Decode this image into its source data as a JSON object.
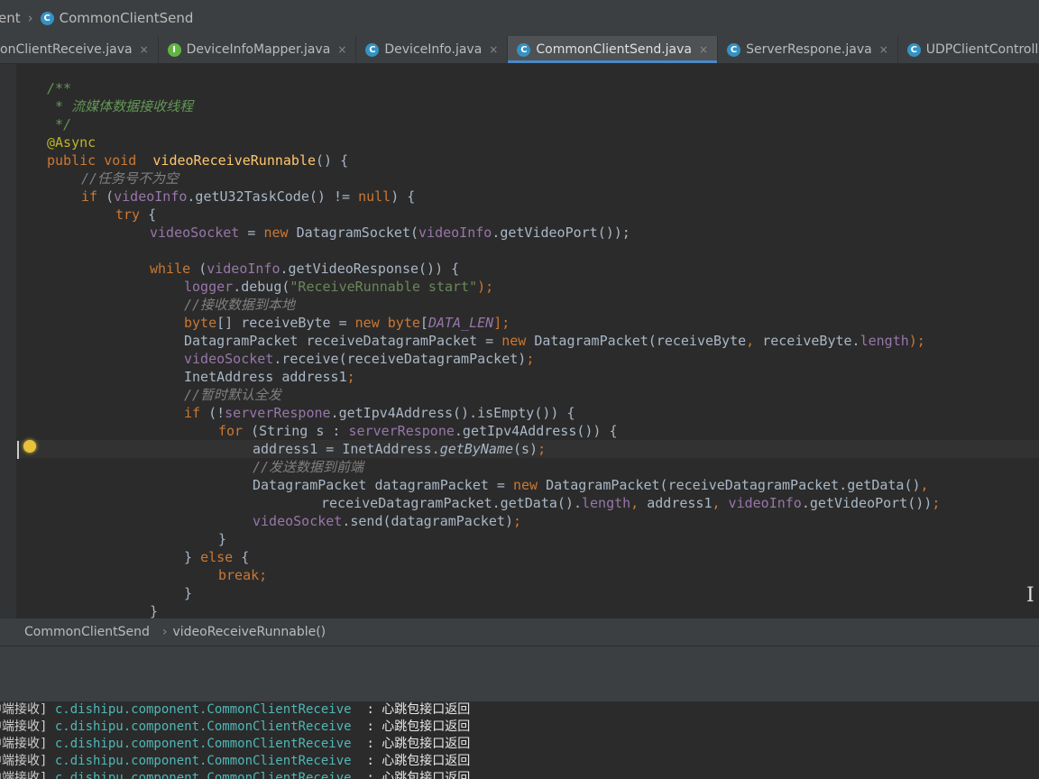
{
  "nav": {
    "crumb_partial": "ent",
    "file": "CommonClientSend"
  },
  "tabs": [
    {
      "label": "onClientReceive.java",
      "icon": "class",
      "active": false
    },
    {
      "label": "DeviceInfoMapper.java",
      "icon": "interface",
      "active": false
    },
    {
      "label": "DeviceInfo.java",
      "icon": "class",
      "active": false
    },
    {
      "label": "CommonClientSend.java",
      "icon": "class",
      "active": true
    },
    {
      "label": "ServerRespone.java",
      "icon": "class",
      "active": false
    },
    {
      "label": "UDPClientController.java",
      "icon": "class",
      "active": false
    }
  ],
  "tab_close_glyph": "×",
  "editor": {
    "lines": [
      {
        "indent": 0,
        "tokens": [
          {
            "t": "/**",
            "c": "doc"
          }
        ]
      },
      {
        "indent": 0,
        "tokens": [
          {
            "t": " * 流媒体数据接收线程",
            "c": "doc"
          }
        ]
      },
      {
        "indent": 0,
        "tokens": [
          {
            "t": " */",
            "c": "doc"
          }
        ]
      },
      {
        "indent": 0,
        "tokens": [
          {
            "t": "@Async",
            "c": "ann"
          }
        ]
      },
      {
        "indent": 0,
        "tokens": [
          {
            "t": "public void ",
            "c": "kw"
          },
          {
            "t": " videoReceiveRunnable",
            "c": "fn"
          },
          {
            "t": "() {",
            "c": ""
          }
        ]
      },
      {
        "indent": 1,
        "tokens": [
          {
            "t": "//任务号不为空",
            "c": "cm"
          }
        ]
      },
      {
        "indent": 1,
        "tokens": [
          {
            "t": "if ",
            "c": "kw"
          },
          {
            "t": "(",
            "c": ""
          },
          {
            "t": "videoInfo",
            "c": "fld"
          },
          {
            "t": ".getU32TaskCode() != ",
            "c": ""
          },
          {
            "t": "null",
            "c": "kw"
          },
          {
            "t": ") {",
            "c": ""
          }
        ]
      },
      {
        "indent": 2,
        "tokens": [
          {
            "t": "try ",
            "c": "kw"
          },
          {
            "t": "{",
            "c": ""
          }
        ]
      },
      {
        "indent": 3,
        "tokens": [
          {
            "t": "videoSocket",
            "c": "fld"
          },
          {
            "t": " = ",
            "c": ""
          },
          {
            "t": "new ",
            "c": "kw"
          },
          {
            "t": "DatagramSocket(",
            "c": ""
          },
          {
            "t": "videoInfo",
            "c": "fld"
          },
          {
            "t": ".getVideoPort());",
            "c": ""
          }
        ]
      },
      {
        "indent": 0,
        "tokens": []
      },
      {
        "indent": 3,
        "tokens": [
          {
            "t": "while ",
            "c": "kw"
          },
          {
            "t": "(",
            "c": ""
          },
          {
            "t": "videoInfo",
            "c": "fld"
          },
          {
            "t": ".getVideoResponse()) {",
            "c": ""
          }
        ]
      },
      {
        "indent": 4,
        "tokens": [
          {
            "t": "logger",
            "c": "fld"
          },
          {
            "t": ".debug(",
            "c": ""
          },
          {
            "t": "\"ReceiveRunnable start\"",
            "c": "str"
          },
          {
            "t": ");",
            "c": "kw"
          }
        ]
      },
      {
        "indent": 4,
        "tokens": [
          {
            "t": "//接收数据到本地",
            "c": "cm"
          }
        ]
      },
      {
        "indent": 4,
        "tokens": [
          {
            "t": "byte",
            "c": "kw"
          },
          {
            "t": "[] receiveByte = ",
            "c": ""
          },
          {
            "t": "new byte",
            "c": "kw"
          },
          {
            "t": "[",
            "c": ""
          },
          {
            "t": "DATA_LEN",
            "c": "fld ital"
          },
          {
            "t": "];",
            "c": "kw"
          }
        ]
      },
      {
        "indent": 4,
        "tokens": [
          {
            "t": "DatagramPacket receiveDatagramPacket = ",
            "c": ""
          },
          {
            "t": "new ",
            "c": "kw"
          },
          {
            "t": "DatagramPacket(receiveByte",
            "c": ""
          },
          {
            "t": ", ",
            "c": "kw"
          },
          {
            "t": "receiveByte.",
            "c": ""
          },
          {
            "t": "length",
            "c": "fld"
          },
          {
            "t": ");",
            "c": "kw"
          }
        ]
      },
      {
        "indent": 4,
        "tokens": [
          {
            "t": "videoSocket",
            "c": "fld"
          },
          {
            "t": ".receive(receiveDatagramPacket)",
            "c": ""
          },
          {
            "t": ";",
            "c": "kw"
          }
        ]
      },
      {
        "indent": 4,
        "tokens": [
          {
            "t": "InetAddress address1",
            "c": ""
          },
          {
            "t": ";",
            "c": "kw"
          }
        ]
      },
      {
        "indent": 4,
        "tokens": [
          {
            "t": "//暂时默认全发",
            "c": "cm"
          }
        ]
      },
      {
        "indent": 4,
        "tokens": [
          {
            "t": "if ",
            "c": "kw"
          },
          {
            "t": "(!",
            "c": ""
          },
          {
            "t": "serverRespone",
            "c": "fld"
          },
          {
            "t": ".getIpv4Address().isEmpty()) {",
            "c": ""
          }
        ]
      },
      {
        "indent": 5,
        "tokens": [
          {
            "t": "for ",
            "c": "kw"
          },
          {
            "t": "(String s : ",
            "c": ""
          },
          {
            "t": "serverRespone",
            "c": "fld"
          },
          {
            "t": ".getIpv4Address()) {",
            "c": ""
          }
        ]
      },
      {
        "indent": 6,
        "tokens": [
          {
            "t": "address1 = InetAddress.",
            "c": ""
          },
          {
            "t": "getByName",
            "c": "ital"
          },
          {
            "t": "(s)",
            "c": ""
          },
          {
            "t": ";",
            "c": "kw"
          }
        ]
      },
      {
        "indent": 6,
        "tokens": [
          {
            "t": "//发送数据到前端",
            "c": "cm"
          }
        ]
      },
      {
        "indent": 6,
        "tokens": [
          {
            "t": "DatagramPacket datagramPacket = ",
            "c": ""
          },
          {
            "t": "new ",
            "c": "kw"
          },
          {
            "t": "DatagramPacket(receiveDatagramPacket.getData()",
            "c": ""
          },
          {
            "t": ",",
            "c": "kw"
          }
        ]
      },
      {
        "indent": 8,
        "tokens": [
          {
            "t": "receiveDatagramPacket.getData().",
            "c": ""
          },
          {
            "t": "length",
            "c": "fld"
          },
          {
            "t": ", ",
            "c": "kw"
          },
          {
            "t": "address1",
            "c": ""
          },
          {
            "t": ", ",
            "c": "kw"
          },
          {
            "t": "videoInfo",
            "c": "fld"
          },
          {
            "t": ".getVideoPort())",
            "c": ""
          },
          {
            "t": ";",
            "c": "kw"
          }
        ]
      },
      {
        "indent": 6,
        "tokens": [
          {
            "t": "videoSocket",
            "c": "fld"
          },
          {
            "t": ".send(datagramPacket)",
            "c": ""
          },
          {
            "t": ";",
            "c": "kw"
          }
        ]
      },
      {
        "indent": 5,
        "tokens": [
          {
            "t": "}",
            "c": ""
          }
        ]
      },
      {
        "indent": 4,
        "tokens": [
          {
            "t": "} ",
            "c": ""
          },
          {
            "t": "else ",
            "c": "kw"
          },
          {
            "t": "{",
            "c": ""
          }
        ]
      },
      {
        "indent": 5,
        "tokens": [
          {
            "t": "break;",
            "c": "kw"
          }
        ]
      },
      {
        "indent": 4,
        "tokens": [
          {
            "t": "}",
            "c": ""
          }
        ]
      },
      {
        "indent": 3,
        "tokens": [
          {
            "t": "}",
            "c": ""
          }
        ]
      }
    ]
  },
  "breadcrumb": {
    "class_name": "CommonClientSend",
    "method_name": "videoReceiveRunnable()",
    "separator": "›"
  },
  "console": {
    "lines": [
      {
        "prefix": "中端接收] ",
        "logger": "c.dishipu.component.CommonClientReceive",
        "msg": "  : 心跳包接口返回"
      },
      {
        "prefix": "中端接收] ",
        "logger": "c.dishipu.component.CommonClientReceive",
        "msg": "  : 心跳包接口返回"
      },
      {
        "prefix": "中端接收] ",
        "logger": "c.dishipu.component.CommonClientReceive",
        "msg": "  : 心跳包接口返回"
      },
      {
        "prefix": "中端接收] ",
        "logger": "c.dishipu.component.CommonClientReceive",
        "msg": "  : 心跳包接口返回"
      },
      {
        "prefix": "中端接收] ",
        "logger": "c.dishipu.component.CommonClientReceive",
        "msg": "  : 心跳包接口返回"
      }
    ]
  },
  "colors": {
    "keyword": "#cc7832",
    "comment": "#808080",
    "doc_comment": "#629755",
    "annotation": "#bbb529",
    "string": "#6a8759",
    "field": "#9876aa",
    "method_decl": "#ffc66d",
    "text": "#a9b7c6",
    "logger": "#4fb7b7",
    "accent": "#4a88c7"
  }
}
